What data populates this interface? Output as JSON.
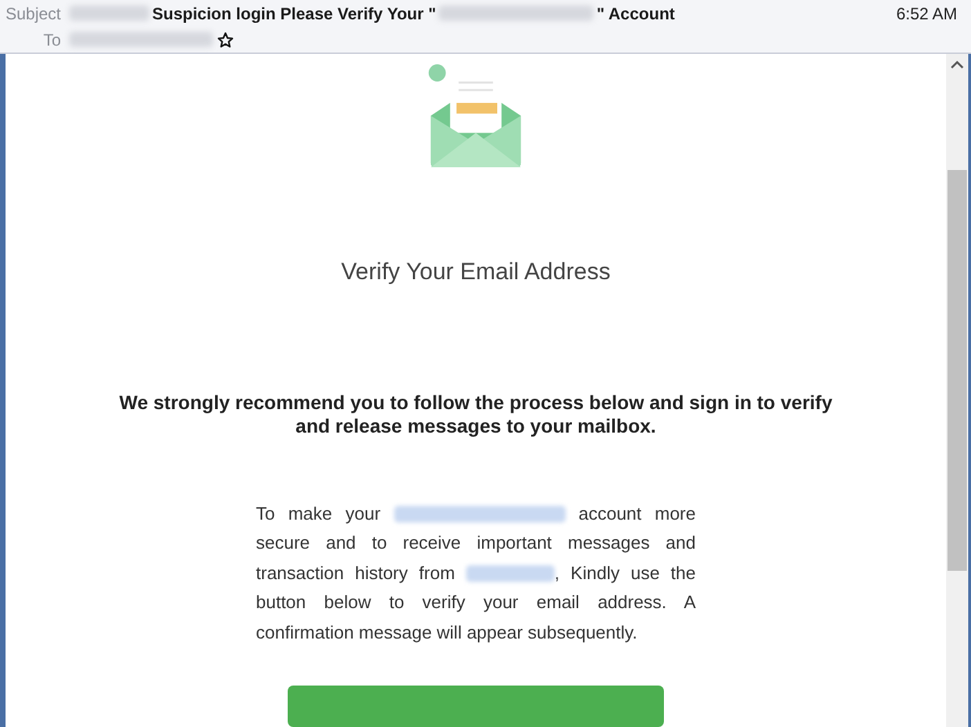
{
  "header": {
    "subject_label": "Subject",
    "subject_parts": [
      {
        "kind": "redacted"
      },
      {
        "kind": "text",
        "text": "Suspicion login Please Verify Your \""
      },
      {
        "kind": "redacted"
      },
      {
        "kind": "text",
        "text": "\" Account"
      }
    ],
    "to_label": "To",
    "starred": false,
    "time": "6:52 AM"
  },
  "body": {
    "heading": "Verify Your Email Address",
    "lead": "We strongly recommend you to follow the process below and sign in to verify and release messages to your mailbox.",
    "paragraph": [
      {
        "kind": "text",
        "text": "To make your "
      },
      {
        "kind": "redacted"
      },
      {
        "kind": "text",
        "text": " account more secure and to receive important messages and transaction history from "
      },
      {
        "kind": "redacted"
      },
      {
        "kind": "text",
        "text": ", Kindly use the button below to verify your email address. A confirmation message will appear subsequently."
      }
    ]
  }
}
